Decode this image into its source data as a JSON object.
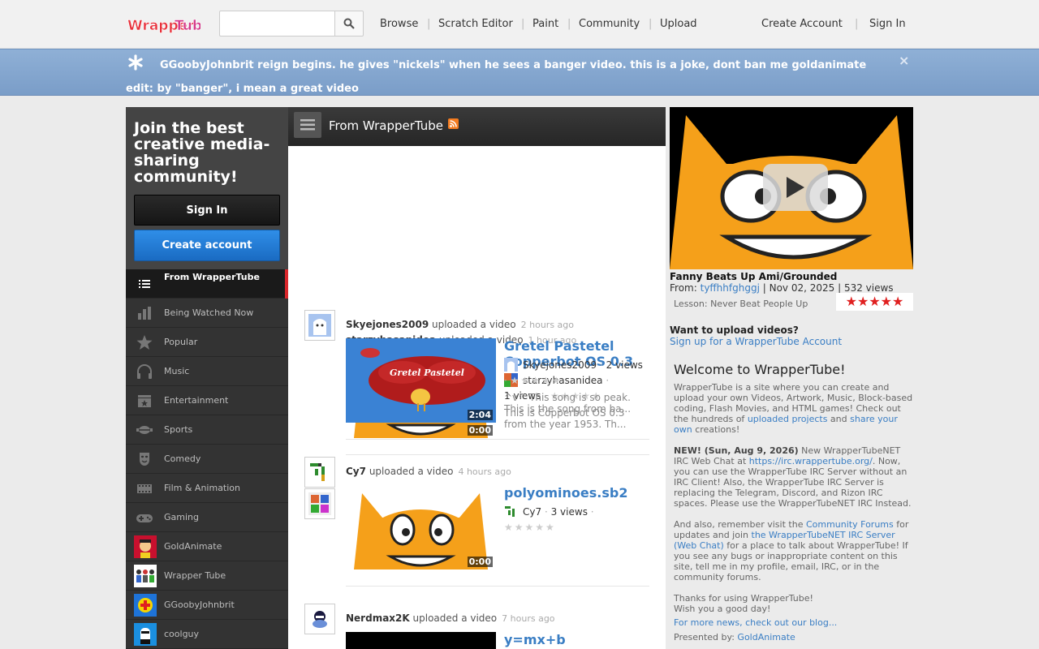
{
  "header": {
    "logo_text": "WrapperTube",
    "search": {
      "placeholder": "",
      "value": ""
    },
    "nav": [
      "Browse",
      "Scratch Editor",
      "Paint",
      "Community",
      "Upload"
    ],
    "account": {
      "create": "Create Account",
      "signin": "Sign In"
    }
  },
  "announcement": {
    "text": "GGoobyJohnbrit reign begins. he gives \"nickels\" when he sees a banger video. this is a joke, dont ban me goldanimate edit: by \"banger\", i mean a great video",
    "close": "×"
  },
  "sidebar": {
    "join_title": "Join the best creative media-sharing community!",
    "signin_label": "Sign In",
    "create_label": "Create account",
    "items": [
      {
        "label": "From WrapperTube",
        "icon": "list-icon"
      },
      {
        "label": "Being Watched Now",
        "icon": "bar-chart-icon"
      },
      {
        "label": "Popular",
        "icon": "star-icon"
      },
      {
        "label": "Music",
        "icon": "headphones-icon"
      },
      {
        "label": "Entertainment",
        "icon": "clapperboard-icon"
      },
      {
        "label": "Sports",
        "icon": "ball-icon"
      },
      {
        "label": "Comedy",
        "icon": "mask-icon"
      },
      {
        "label": "Film & Animation",
        "icon": "film-icon"
      },
      {
        "label": "Gaming",
        "icon": "gamepad-icon"
      },
      {
        "label": "GoldAnimate",
        "icon": "avatar-goldanimate"
      },
      {
        "label": "Wrapper Tube",
        "icon": "avatar-wrappertube"
      },
      {
        "label": "GGoobyJohnbrit",
        "icon": "avatar-ggooby"
      },
      {
        "label": "coolguy",
        "icon": "avatar-coolguy"
      }
    ]
  },
  "feed": {
    "title": "From WrapperTube",
    "entries": [
      {
        "user": "starzyhasanidea",
        "action": "uploaded a video",
        "time": "1 hour ago",
        "title": "Copperbot OS 0.3",
        "duration": "0:00",
        "views": "1 views",
        "desc": "This is Copperbot OS 0.3 from the year 1953. Th..."
      },
      {
        "user": "Skyejones2009",
        "action": "uploaded a video",
        "time": "2 hours ago",
        "title": "Gretel Pastetel",
        "duration": "2:04",
        "views": "2 views",
        "desc": "^v^ This song is so peak. This is the song from ba...",
        "thumb_text": "Gretel Pastetel"
      },
      {
        "user": "Cy7",
        "action": "uploaded a video",
        "time": "4 hours ago",
        "title": "polyominoes.sb2",
        "duration": "0:00",
        "views": "3 views",
        "desc": ""
      },
      {
        "user": "Nerdmax2K",
        "action": "uploaded a video",
        "time": "7 hours ago",
        "title": "y=mx+b",
        "duration": "",
        "views": "",
        "desc": ""
      }
    ]
  },
  "right": {
    "video_title": "Fanny Beats Up Ami/Grounded",
    "from_label": "From:",
    "from_user": "tyffhhfghggj",
    "date_views": "| Nov 02, 2025 | 532 views",
    "lesson": "Lesson: Never Beat People Up",
    "rating": 5,
    "upload_q": "Want to upload videos?",
    "upload_link": "Sign up for a WrapperTube Account",
    "welcome_title": "Welcome to WrapperTube!",
    "p1_a": "WrapperTube is a site where you can create and upload your own Videos, Artwork, Music, Block-based coding, Flash Movies, and HTML games! Check out the hundreds of ",
    "p1_link1": "uploaded projects",
    "p1_b": " and ",
    "p1_link2": "share your own",
    "p1_c": " creations!",
    "p2_bold": "NEW! (Sun, Aug 9, 2026)",
    "p2_a": " New WrapperTubeNET IRC Web Chat at ",
    "p2_link": "https://irc.wrappertube.org/",
    "p2_b": ". Now, you can use the WrapperTube IRC Server without an IRC Client! Also, the WrapperTube IRC Server is replacing the Telegram, Discord, and Rizon IRC spaces. Please use the WrapperTubeNET IRC Instead.",
    "p3_a": "And also, remember visit the ",
    "p3_link1": "Community Forums",
    "p3_b": " for updates and join ",
    "p3_link2": "the WrapperTubeNET IRC Server (Web Chat)",
    "p3_c": " for a place to talk about WrapperTube! If you see any bugs or inappropriate content on this site, tell me in my profile, email, IRC, or in the community forums.",
    "p4_a": "Thanks for using WrapperTube!",
    "p4_b": "Wish you a good day!",
    "blog_link": "For more news, check out our blog...",
    "presented_label": "Presented by: ",
    "presented_user": "GoldAnimate"
  },
  "colors": {
    "link": "#3a7ec4",
    "announce_bg": "#85a7d0",
    "active_bar": "#d9262b",
    "rating": "#e02020"
  }
}
